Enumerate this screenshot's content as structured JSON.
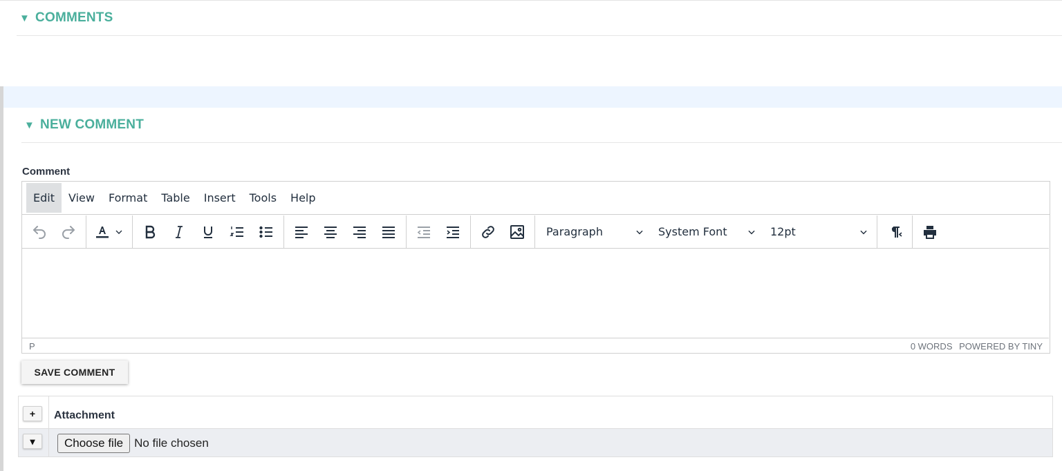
{
  "comments_section": {
    "arrow": "▼",
    "title": "COMMENTS"
  },
  "new_comment_section": {
    "arrow": "▼",
    "title": "NEW COMMENT"
  },
  "comment_field": {
    "label": "Comment"
  },
  "editor": {
    "menubar": [
      "Edit",
      "View",
      "Format",
      "Table",
      "Insert",
      "Tools",
      "Help"
    ],
    "active_menu": "Edit",
    "toolbar": {
      "block_format": "Paragraph",
      "font_family": "System Font",
      "font_size": "12pt"
    },
    "icons": [
      "undo-icon",
      "redo-icon",
      "text-color-icon",
      "bold-icon",
      "italic-icon",
      "underline-icon",
      "numbered-list-icon",
      "bullet-list-icon",
      "align-left-icon",
      "align-center-icon",
      "align-right-icon",
      "justify-icon",
      "outdent-icon",
      "indent-icon",
      "link-icon",
      "image-icon",
      "ltr-rtl-icon",
      "print-icon"
    ],
    "status": {
      "path": "P",
      "word_count": "0 WORDS",
      "branding": "POWERED BY TINY"
    }
  },
  "save_button": {
    "label": "SAVE COMMENT"
  },
  "attachments": {
    "add_label": "+",
    "expand_label": "▾",
    "column_header": "Attachment",
    "choose_file_label": "Choose file",
    "no_file_text": "No file chosen"
  },
  "colors": {
    "accent": "#4aaf9c",
    "band": "#edf5ff",
    "toolbar_text": "#222f3e"
  }
}
